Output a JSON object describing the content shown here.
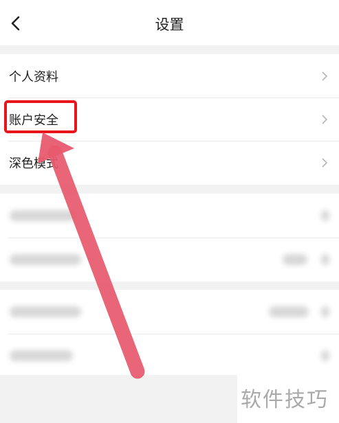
{
  "header": {
    "title": "设置"
  },
  "settings": {
    "items": [
      {
        "label": "个人资料"
      },
      {
        "label": "账户安全"
      },
      {
        "label": "深色模式"
      }
    ]
  },
  "watermark": "软件技巧",
  "colors": {
    "highlight": "#e8161b",
    "arrow": "#e85a6e",
    "page_background": "#f2f2f2",
    "card_background": "#ffffff"
  },
  "icons": {
    "back": "chevron-left-icon",
    "row_arrow": "chevron-right-icon"
  }
}
